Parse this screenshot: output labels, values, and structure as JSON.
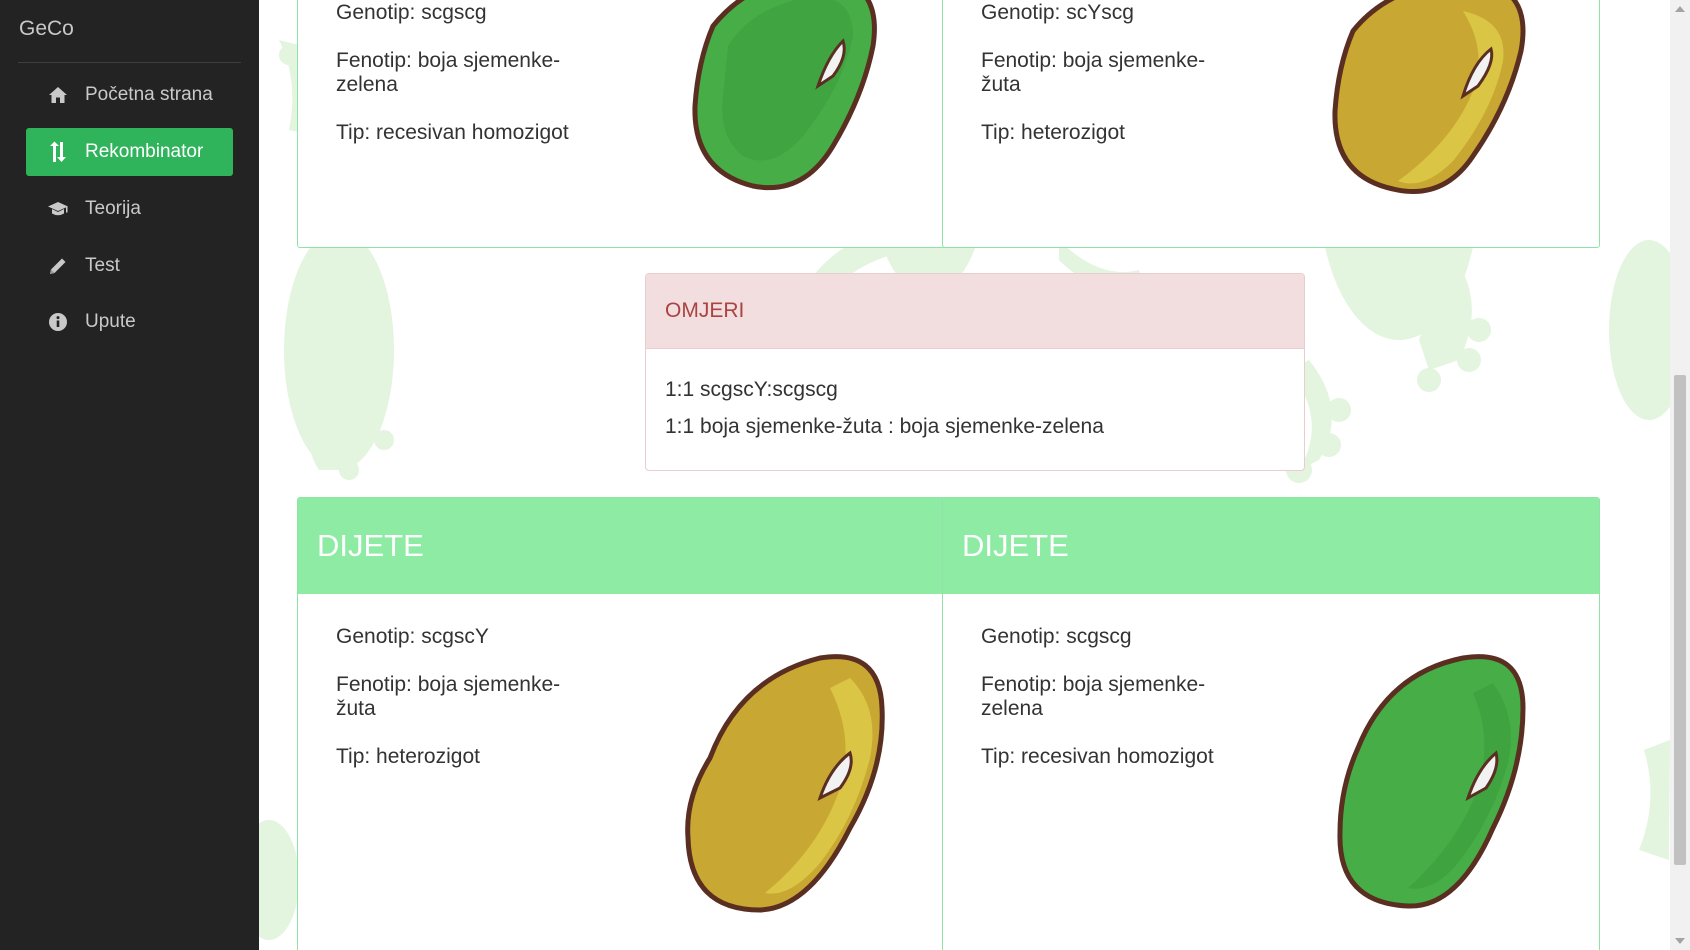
{
  "app": {
    "brand": "GeCo"
  },
  "nav": {
    "items": [
      {
        "label": "Početna strana",
        "icon": "home-icon"
      },
      {
        "label": "Rekombinator",
        "icon": "sort-arrows-icon",
        "active": true
      },
      {
        "label": "Teorija",
        "icon": "graduation-cap-icon"
      },
      {
        "label": "Test",
        "icon": "pencil-icon"
      },
      {
        "label": "Upute",
        "icon": "info-circle-icon"
      }
    ]
  },
  "parents": [
    {
      "genotype": "Genotip: scgscg",
      "phenotype": "Fenotip: boja sjemenke-zelena",
      "type": "Tip: recesivan homozigot",
      "bean_color": "green"
    },
    {
      "genotype": "Genotip: scYscg",
      "phenotype": "Fenotip: boja sjemenke-žuta",
      "type": "Tip: heterozigot",
      "bean_color": "yellow"
    }
  ],
  "ratios": {
    "title": "OMJERI",
    "lines": [
      "1:1 scgscY:scgscg",
      "1:1 boja sjemenke-žuta : boja sjemenke-zelena"
    ]
  },
  "children": [
    {
      "title": "DIJETE",
      "genotype": "Genotip: scgscY",
      "phenotype": "Fenotip: boja sjemenke-žuta",
      "type": "Tip: heterozigot",
      "bean_color": "yellow"
    },
    {
      "title": "DIJETE",
      "genotype": "Genotip: scgscg",
      "phenotype": "Fenotip: boja sjemenke-zelena",
      "type": "Tip: recesivan homozigot",
      "bean_color": "green"
    }
  ],
  "colors": {
    "sidebar_bg": "#232323",
    "accent_green": "#2fb35b",
    "card_header": "#8eeba4",
    "ratios_header_bg": "#f2dede",
    "ratios_header_text": "#a94442",
    "bean_green": "#47ad47",
    "bean_yellow": "#c8a832",
    "bean_outline": "#5a2f22"
  }
}
